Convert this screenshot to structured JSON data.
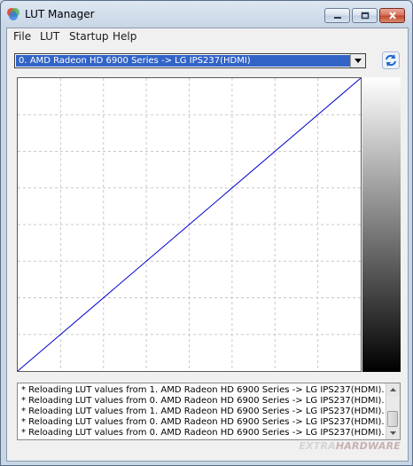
{
  "window": {
    "title": "LUT Manager",
    "icon": "lut-manager-app-icon"
  },
  "menu": {
    "items": [
      "File",
      "LUT",
      "Startup",
      "Help"
    ]
  },
  "device_select": {
    "selected": "0. AMD Radeon HD 6900 Series -> LG IPS237(HDMI)"
  },
  "toolbar": {
    "refresh_icon": "refresh-icon"
  },
  "lut_chart": {
    "type": "line",
    "grid": true,
    "line_color": "#0000cc",
    "x": [
      0,
      1
    ],
    "y": [
      0,
      1
    ]
  },
  "gradient": {
    "from": "#ffffff",
    "to": "#000000"
  },
  "log": {
    "lines": [
      "* Reloading LUT values from 1. AMD Radeon HD 6900 Series -> LG IPS237(HDMI).",
      "* Reloading LUT values from 0. AMD Radeon HD 6900 Series -> LG IPS237(HDMI).",
      "* Reloading LUT values from 1. AMD Radeon HD 6900 Series -> LG IPS237(HDMI).",
      "* Reloading LUT values from 0. AMD Radeon HD 6900 Series -> LG IPS237(HDMI).",
      "* Reloading LUT values from 0. AMD Radeon HD 6900 Series -> LG IPS237(HDMI)."
    ]
  },
  "watermark": {
    "part1": "EXTRA",
    "part2": "HARDWARE"
  }
}
